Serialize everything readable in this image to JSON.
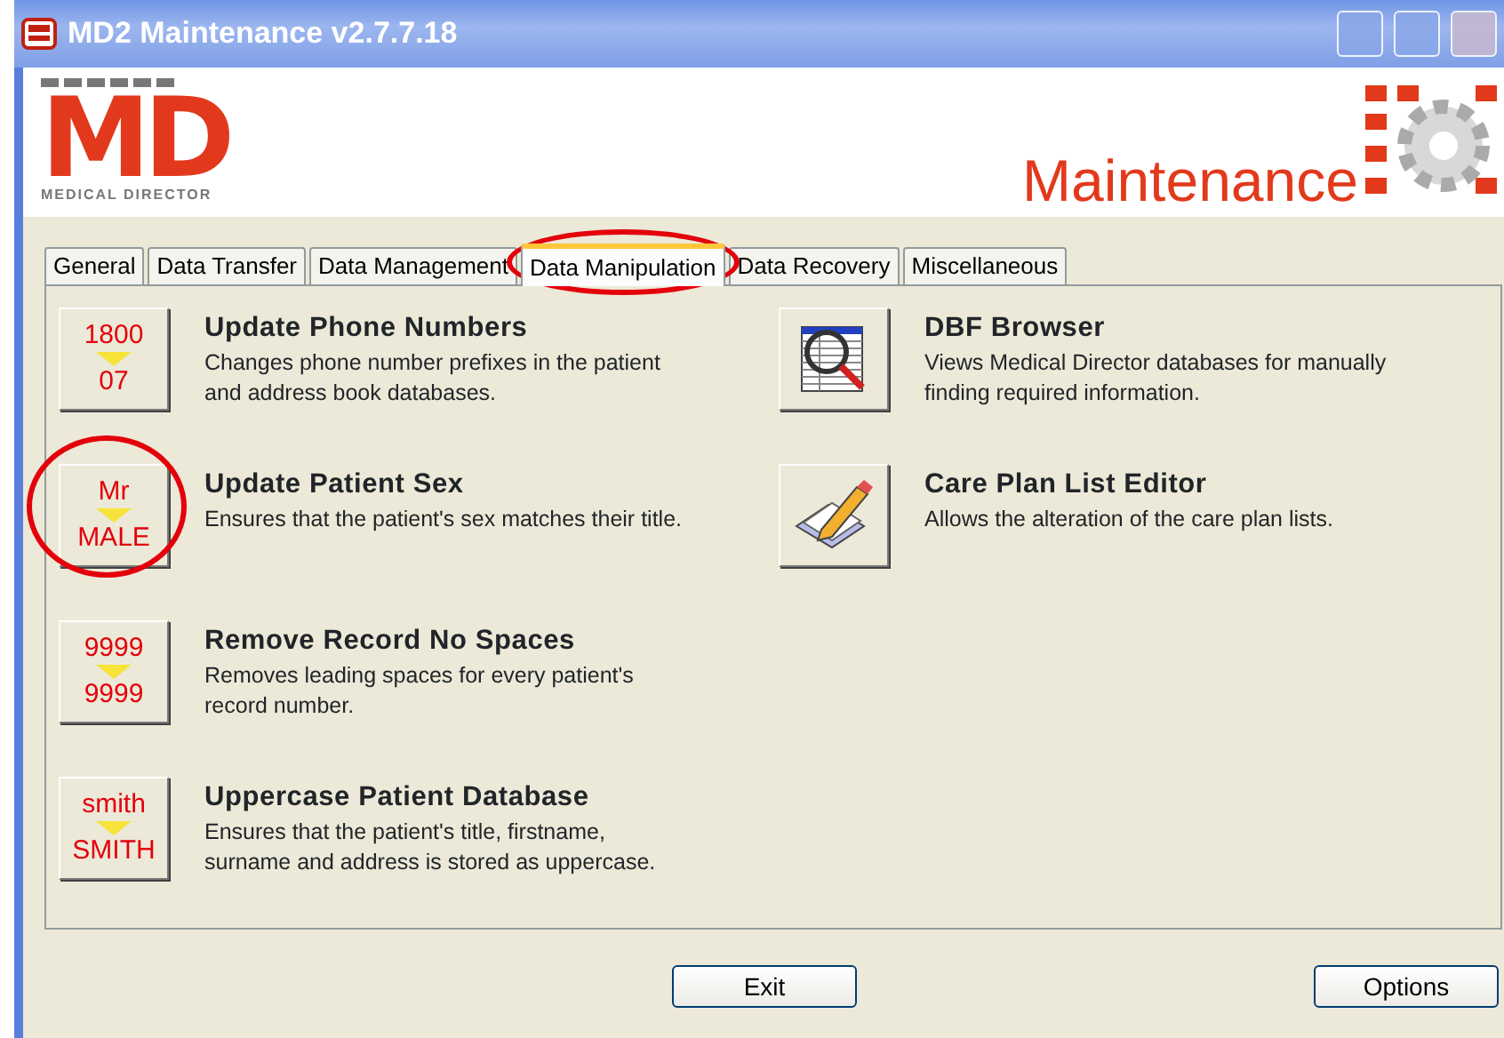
{
  "window": {
    "title": "MD2 Maintenance v2.7.7.18"
  },
  "header": {
    "logo_letters": "MD",
    "logo_caption": "MEDICAL DIRECTOR",
    "banner": "Maintenance"
  },
  "tabs": [
    {
      "label": "General",
      "selected": false,
      "highlighted": false
    },
    {
      "label": "Data Transfer",
      "selected": false,
      "highlighted": false
    },
    {
      "label": "Data Management",
      "selected": false,
      "highlighted": false
    },
    {
      "label": "Data Manipulation",
      "selected": true,
      "highlighted": true
    },
    {
      "label": "Data Recovery",
      "selected": false,
      "highlighted": false
    },
    {
      "label": "Miscellaneous",
      "selected": false,
      "highlighted": false
    }
  ],
  "left_tools": [
    {
      "kind": "convert",
      "from": "1800",
      "to": "07",
      "title": "Update Phone Numbers",
      "description": "Changes phone number prefixes in the patient and address book databases.",
      "highlighted": false
    },
    {
      "kind": "convert",
      "from": "Mr",
      "to": "MALE",
      "title": "Update Patient Sex",
      "description": "Ensures that the patient's sex matches their title.",
      "highlighted": true
    },
    {
      "kind": "convert",
      "from": "9999",
      "to": "9999",
      "title": "Remove Record No Spaces",
      "description": "Removes leading spaces for every patient's record number.",
      "highlighted": false
    },
    {
      "kind": "convert",
      "from": "smith",
      "to": "SMITH",
      "title": "Uppercase Patient Database",
      "description": "Ensures that the patient's title, firstname, surname and address is stored as uppercase.",
      "highlighted": false
    }
  ],
  "right_tools": [
    {
      "kind": "browser",
      "title": "DBF Browser",
      "description": "Views Medical Director databases for manually finding required information.",
      "highlighted": false
    },
    {
      "kind": "editor",
      "title": "Care Plan List Editor",
      "description": "Allows the alteration of the care plan lists.",
      "highlighted": false
    }
  ],
  "buttons": [
    "Exit",
    "Options"
  ]
}
